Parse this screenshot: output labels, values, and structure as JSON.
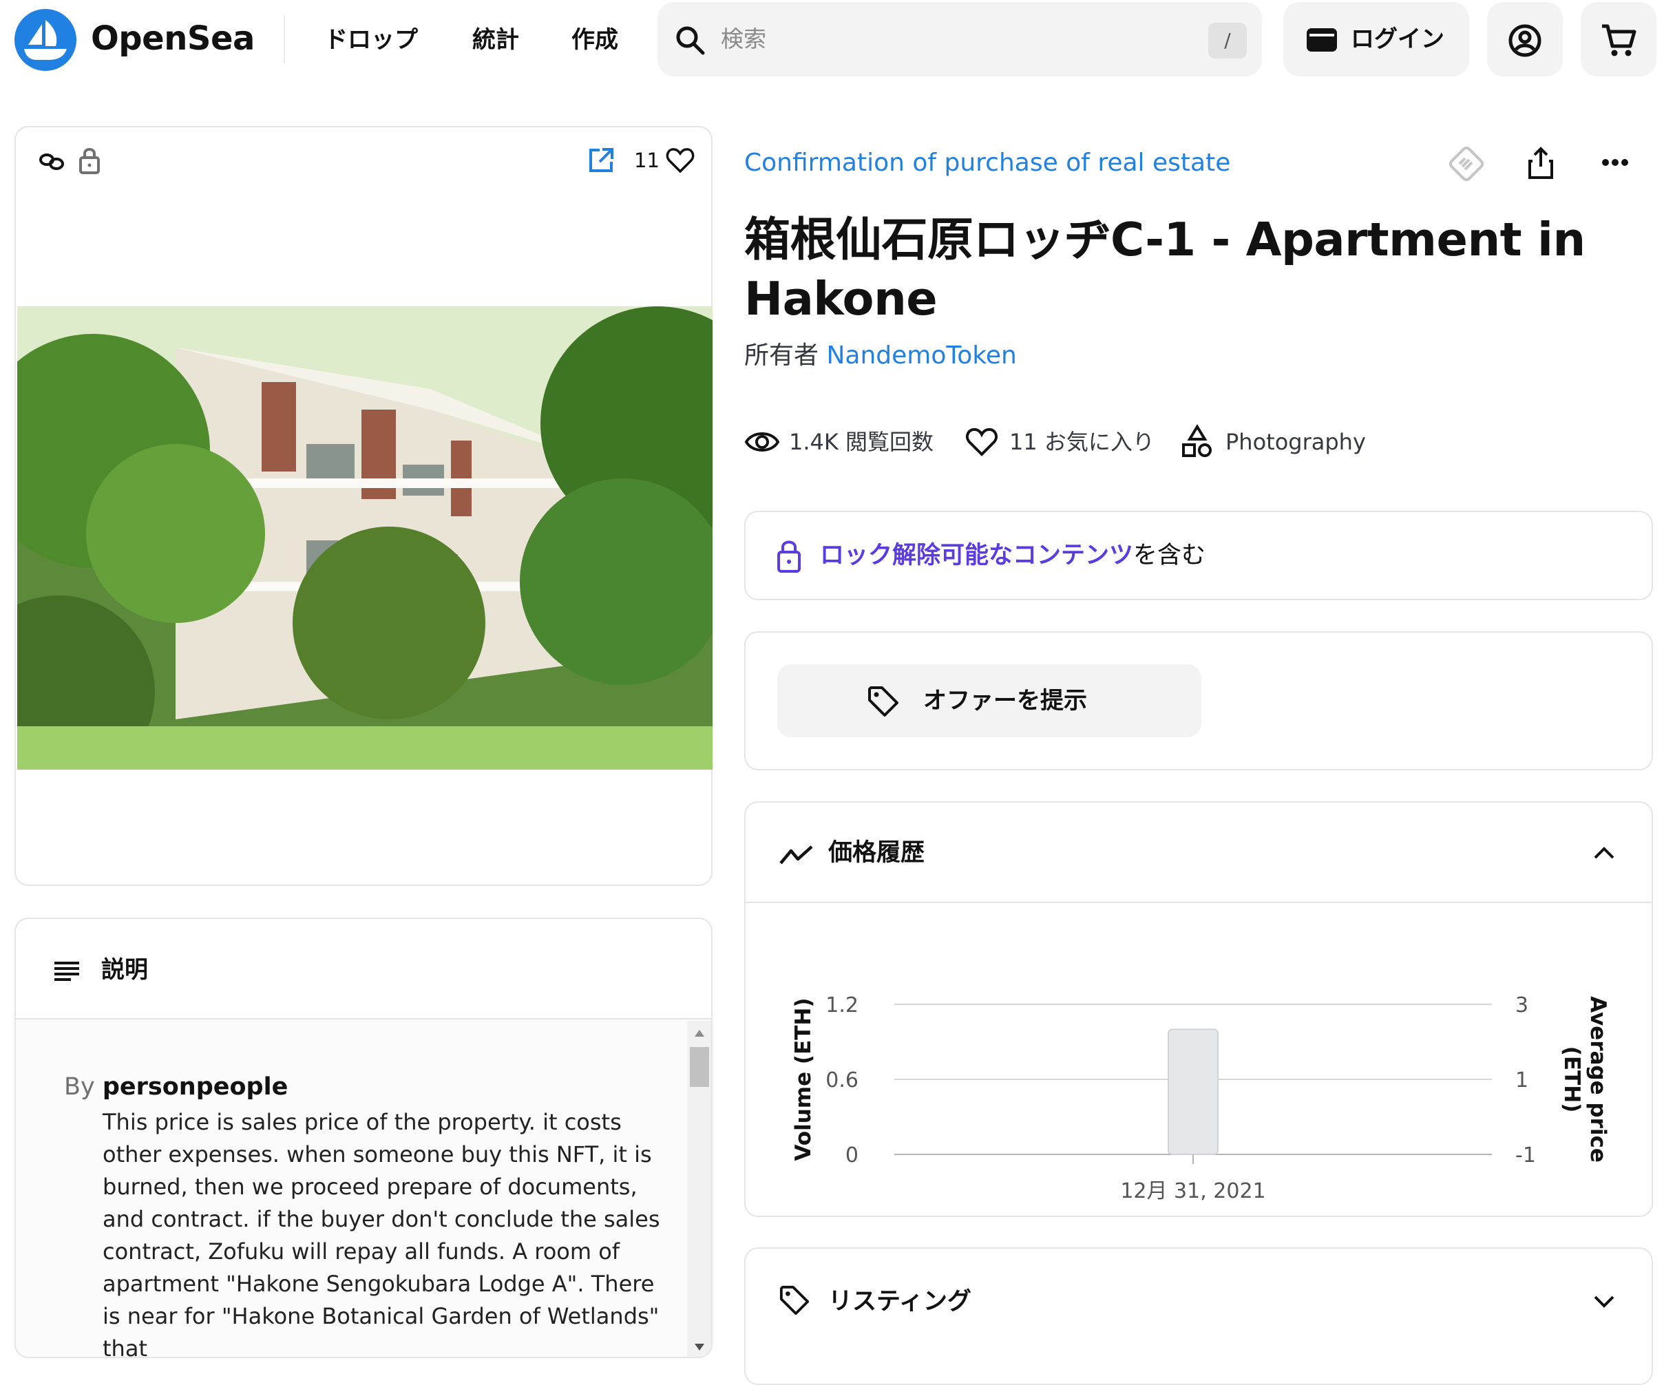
{
  "nav": {
    "brand": "OpenSea",
    "links": [
      "ドロップ",
      "統計",
      "作成"
    ],
    "search_placeholder": "検索",
    "search_shortcut": "/",
    "login_label": "ログイン",
    "accent": "#2081e2"
  },
  "item": {
    "like_count": "11",
    "collection": "Confirmation of purchase of real estate",
    "title": "箱根仙石原ロッヂC-1 - Apartment in Hakone",
    "owner_prefix": "所有者",
    "owner_name": "NandemoToken",
    "views": "1.4K 閲覧回数",
    "favorites": "11 お気に入り",
    "category": "Photography"
  },
  "unlockable": {
    "highlight": "ロック解除可能なコンテンツ",
    "suffix": "を含む",
    "color": "#5a3ce0"
  },
  "offer": {
    "button_label": "オファーを提示"
  },
  "description": {
    "heading": "説明",
    "by_prefix": "By",
    "author": "personpeople",
    "text": "This price is sales price of the property. it costs other expenses. when someone buy this NFT, it is burned, then we proceed prepare of documents, and contract. if the buyer don't conclude the sales contract, Zofuku will repay all funds. A room of apartment \"Hakone Sengokubara Lodge A\". There is near for \"Hakone Botanical Garden of Wetlands\" that"
  },
  "price_history": {
    "heading": "価格履歴"
  },
  "listing": {
    "heading": "リスティング"
  },
  "chart_data": {
    "type": "bar",
    "categories": [
      "12月 31, 2021"
    ],
    "series": [
      {
        "values": [
          1.0
        ]
      }
    ],
    "ylabel": "Volume (ETH)",
    "y2label": "Average price (ETH)",
    "ylim": [
      0,
      1.2
    ],
    "yticks": [
      "1.2",
      "0.6",
      "0"
    ],
    "y2lim": [
      -1,
      3
    ],
    "y2ticks": [
      "3",
      "1",
      "-1"
    ],
    "grid": true,
    "bar_color": "#e5e8eb"
  }
}
